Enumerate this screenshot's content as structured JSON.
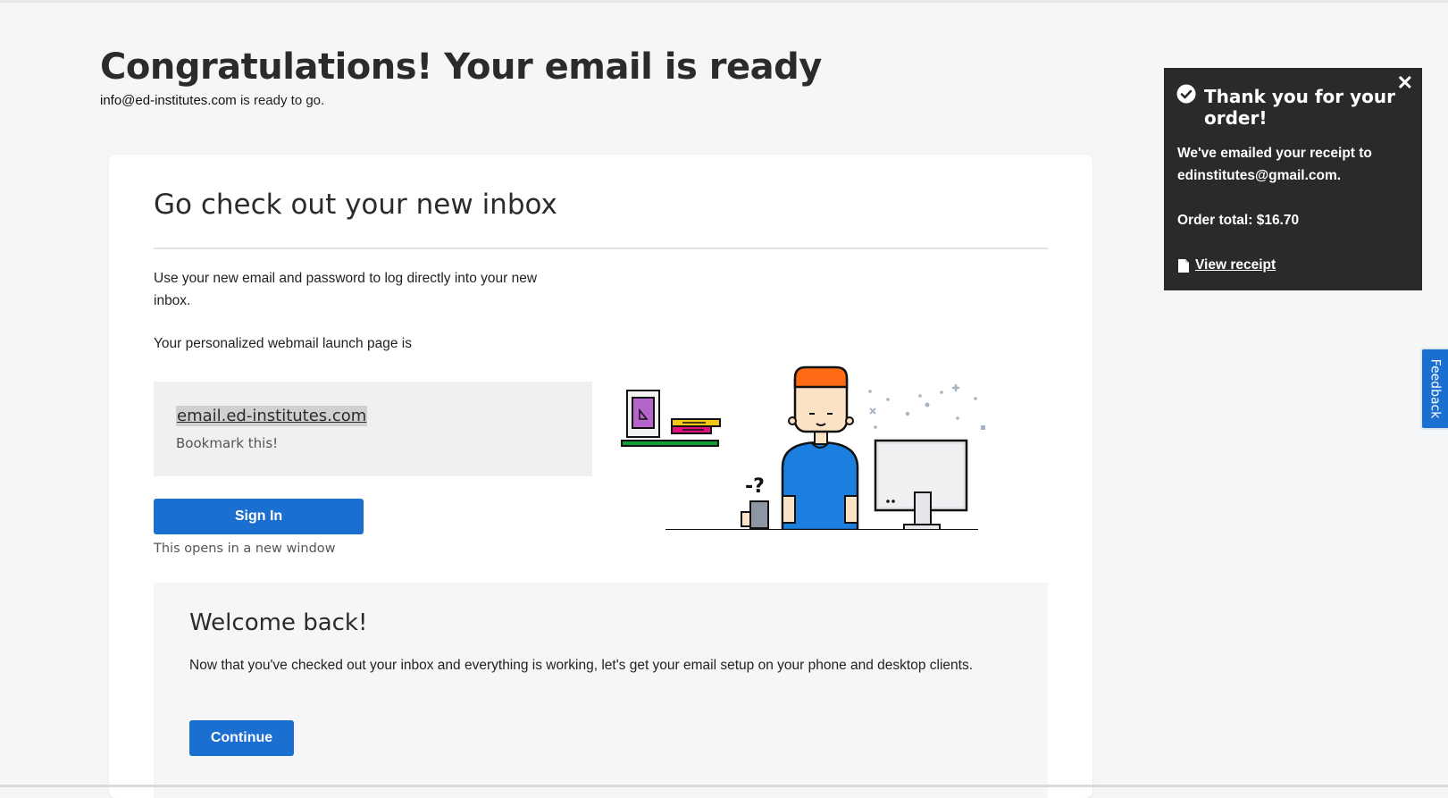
{
  "header": {
    "title": "Congratulations! Your email is ready",
    "email": "info@ed-institutes.com",
    "subtitle_suffix": " is ready to go."
  },
  "inbox_card": {
    "title": "Go check out your new inbox",
    "description": "Use your new email and password to log directly into your new inbox.",
    "launch_text": "Your personalized webmail launch page is",
    "webmail_link": "email.ed-institutes.com",
    "bookmark_note": "Bookmark this!",
    "signin_label": "Sign In",
    "opens_note": "This opens in a new window"
  },
  "welcome": {
    "title": "Welcome back!",
    "text": "Now that you've checked out your inbox and everything is working, let's get your email setup on your phone and desktop clients.",
    "continue_label": "Continue"
  },
  "toast": {
    "title": "Thank you for your order!",
    "receipt_text": "We've emailed your receipt to edinstitutes@gmail.com.",
    "order_total": "Order total: $16.70",
    "view_receipt": "View receipt",
    "close_symbol": "✕"
  },
  "feedback": {
    "label": "Feedback"
  },
  "icons": {
    "close": "close-icon",
    "check": "check-circle-icon",
    "document": "document-icon"
  },
  "colors": {
    "primary_blue": "#1b6fd1",
    "toast_bg": "#2a2a2a",
    "page_bg": "#f5f6f7",
    "desk_green": "#0f9d35",
    "desk_fill": "#d9f2e1"
  }
}
